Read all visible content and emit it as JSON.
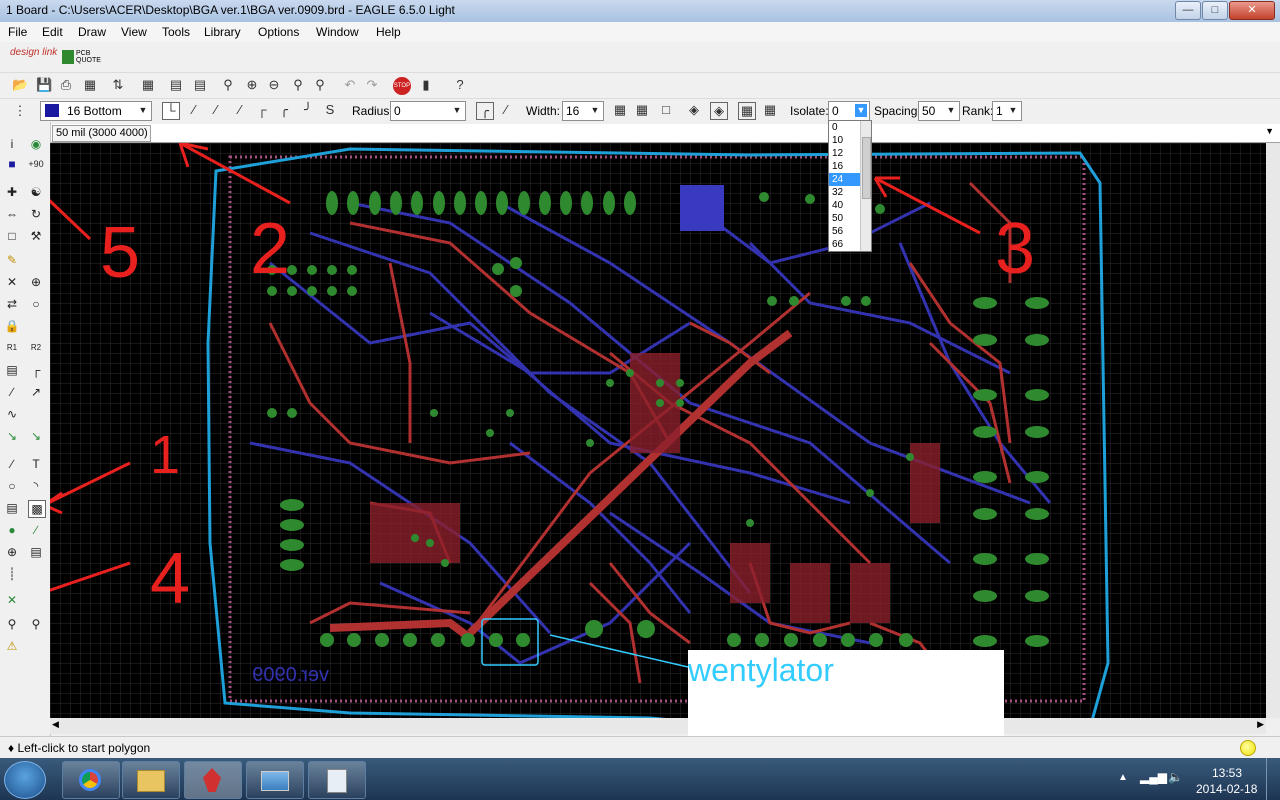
{
  "window": {
    "title": "1 Board - C:\\Users\\ACER\\Desktop\\BGA ver.1\\BGA ver.0909.brd - EAGLE 6.5.0 Light",
    "minimize": "—",
    "maximize": "□",
    "close": "✕"
  },
  "menu": [
    "File",
    "Edit",
    "Draw",
    "View",
    "Tools",
    "Library",
    "Options",
    "Window",
    "Help"
  ],
  "brand": {
    "designlink": "design link",
    "pcbquote": "PCB QUOTE"
  },
  "toolbar2": {
    "layer_value": "16 Bottom",
    "layer_color": "#1a1aa0",
    "radius_label": "Radius:",
    "radius_value": "0",
    "width_label": "Width:",
    "width_value": "16",
    "isolate_label": "Isolate:",
    "isolate_value": "0",
    "spacing_label": "Spacing:",
    "spacing_value": "50",
    "rank_label": "Rank:",
    "rank_value": "1"
  },
  "isolate_options": [
    "0",
    "10",
    "12",
    "16",
    "24",
    "32",
    "40",
    "50",
    "56",
    "66"
  ],
  "isolate_selected": "24",
  "command": {
    "grid_readout": "50 mil (3000 4000)"
  },
  "canvas": {
    "board_label": "ver.0909",
    "annotation": "wentylator",
    "numbers": [
      "1",
      "2",
      "3",
      "4",
      "5"
    ]
  },
  "status": {
    "message": "♦ Left-click to start polygon"
  },
  "taskbar": {
    "time": "13:53",
    "date": "2014-02-18"
  },
  "colors": {
    "top_layer": "#b13030",
    "bottom_layer": "#3333b0",
    "pads": "#2f8a2f",
    "annotation_red": "#e8201e",
    "annotation_blue": "#1ea0d8",
    "annotation_text": "#33ccff"
  }
}
